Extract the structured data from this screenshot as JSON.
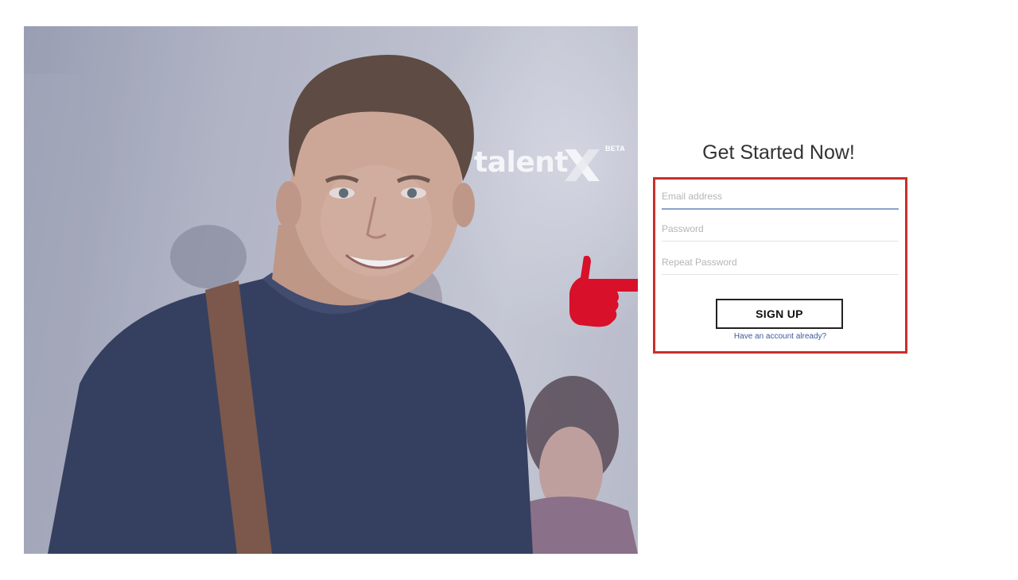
{
  "brand": {
    "name": "talent",
    "badge": "BETA"
  },
  "form": {
    "title": "Get Started Now!",
    "email_placeholder": "Email address",
    "password_placeholder": "Password",
    "repeat_password_placeholder": "Repeat Password",
    "signup_label": "SIGN UP",
    "login_link": "Have an account already?"
  },
  "icons": {
    "brand_mark": "x-logo-icon",
    "annotation": "pointing-hand-icon"
  },
  "colors": {
    "highlight_border": "#c7302b",
    "pointer": "#d9102a",
    "active_field_underline": "#8aa2c8",
    "link": "#3b5b9a"
  }
}
